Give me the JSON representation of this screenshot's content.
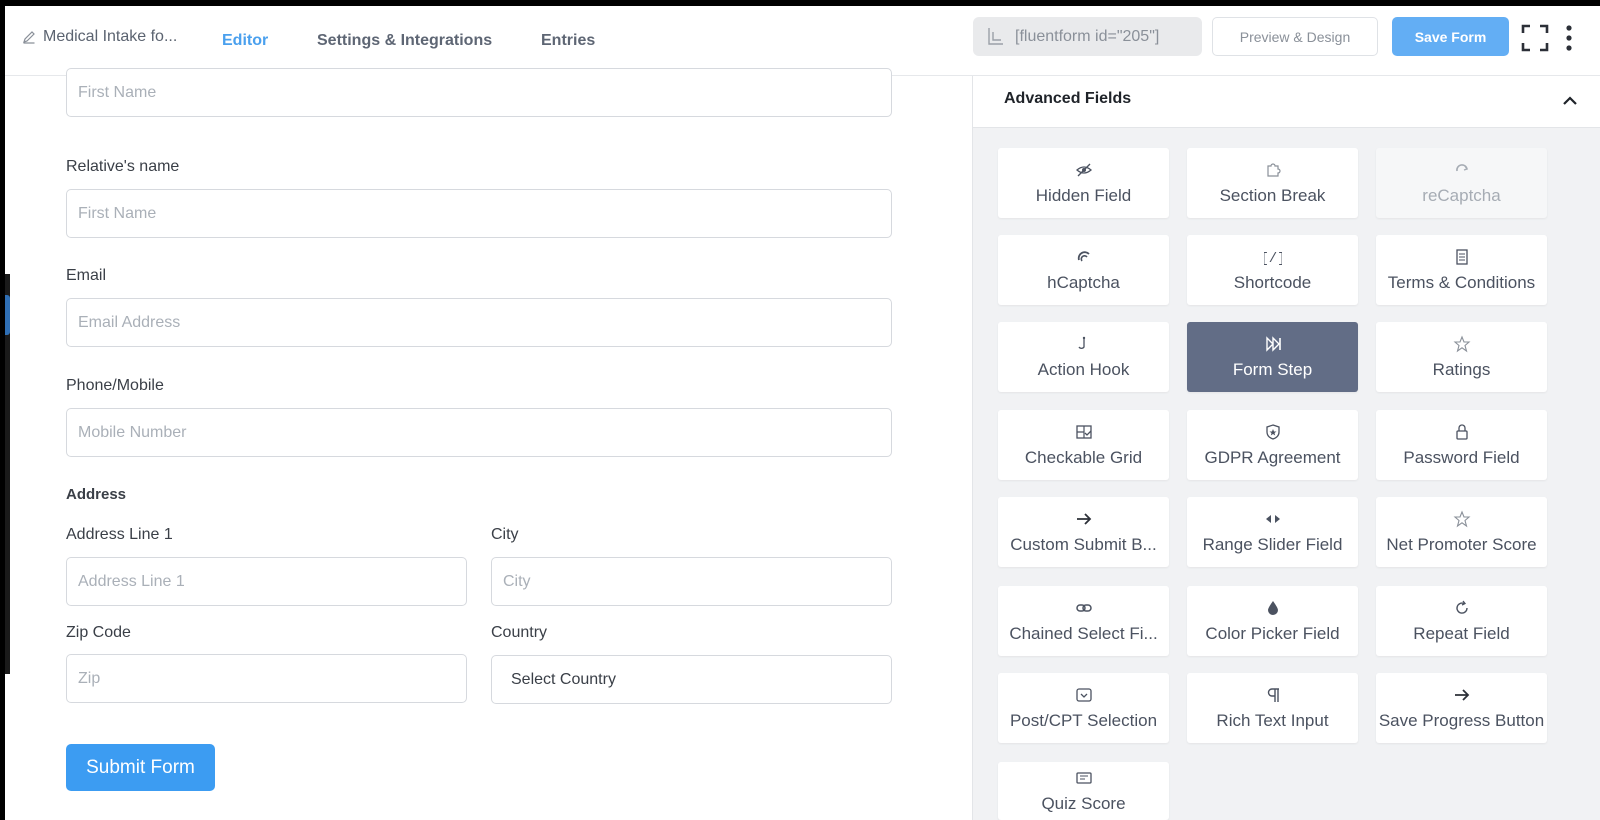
{
  "header": {
    "form_title": "Medical Intake fo...",
    "tabs": [
      "Editor",
      "Settings & Integrations",
      "Entries"
    ],
    "shortcode": "[fluentform id=\"205\"]",
    "preview_label": "Preview & Design",
    "save_label": "Save Form"
  },
  "editor": {
    "top_input_placeholder": "First Name",
    "relative": {
      "label": "Relative's name",
      "placeholder": "First Name"
    },
    "email": {
      "label": "Email",
      "placeholder": "Email Address"
    },
    "phone": {
      "label": "Phone/Mobile",
      "placeholder": "Mobile Number"
    },
    "address": {
      "label": "Address",
      "line1": {
        "label": "Address Line 1",
        "placeholder": "Address Line 1"
      },
      "city": {
        "label": "City",
        "placeholder": "City"
      },
      "zip": {
        "label": "Zip Code",
        "placeholder": "Zip"
      },
      "country": {
        "label": "Country",
        "value": "Select Country"
      }
    },
    "submit_label": "Submit Form"
  },
  "sidebar": {
    "title": "Advanced Fields",
    "fields": [
      {
        "label": "Hidden Field",
        "icon": "eye-slash-icon"
      },
      {
        "label": "Section Break",
        "icon": "puzzle-icon"
      },
      {
        "label": "reCaptcha",
        "icon": "recaptcha-icon",
        "state": "disabled"
      },
      {
        "label": "hCaptcha",
        "icon": "hcaptcha-icon"
      },
      {
        "label": "Shortcode",
        "icon": "shortcode-icon"
      },
      {
        "label": "Terms & Conditions",
        "icon": "document-icon"
      },
      {
        "label": "Action Hook",
        "icon": "hook-icon"
      },
      {
        "label": "Form Step",
        "icon": "step-forward-icon",
        "state": "active"
      },
      {
        "label": "Ratings",
        "icon": "star-icon"
      },
      {
        "label": "Checkable Grid",
        "icon": "grid-check-icon"
      },
      {
        "label": "GDPR Agreement",
        "icon": "shield-icon"
      },
      {
        "label": "Password Field",
        "icon": "lock-icon"
      },
      {
        "label": "Custom Submit B...",
        "icon": "arrow-right-icon"
      },
      {
        "label": "Range Slider Field",
        "icon": "range-slider-icon"
      },
      {
        "label": "Net Promoter Score",
        "icon": "star-icon"
      },
      {
        "label": "Chained Select Fi...",
        "icon": "link-icon"
      },
      {
        "label": "Color Picker Field",
        "icon": "droplet-icon"
      },
      {
        "label": "Repeat Field",
        "icon": "repeat-icon"
      },
      {
        "label": "Post/CPT Selection",
        "icon": "select-box-icon"
      },
      {
        "label": "Rich Text Input",
        "icon": "paragraph-icon"
      },
      {
        "label": "Save Progress Button",
        "icon": "arrow-right-icon"
      },
      {
        "label": "Quiz Score",
        "icon": "quiz-icon"
      }
    ]
  },
  "colors": {
    "accent": "#4aa0ee",
    "save_button": "#63aef4",
    "submit_button": "#3c9cf2",
    "active_card": "#626d86"
  }
}
